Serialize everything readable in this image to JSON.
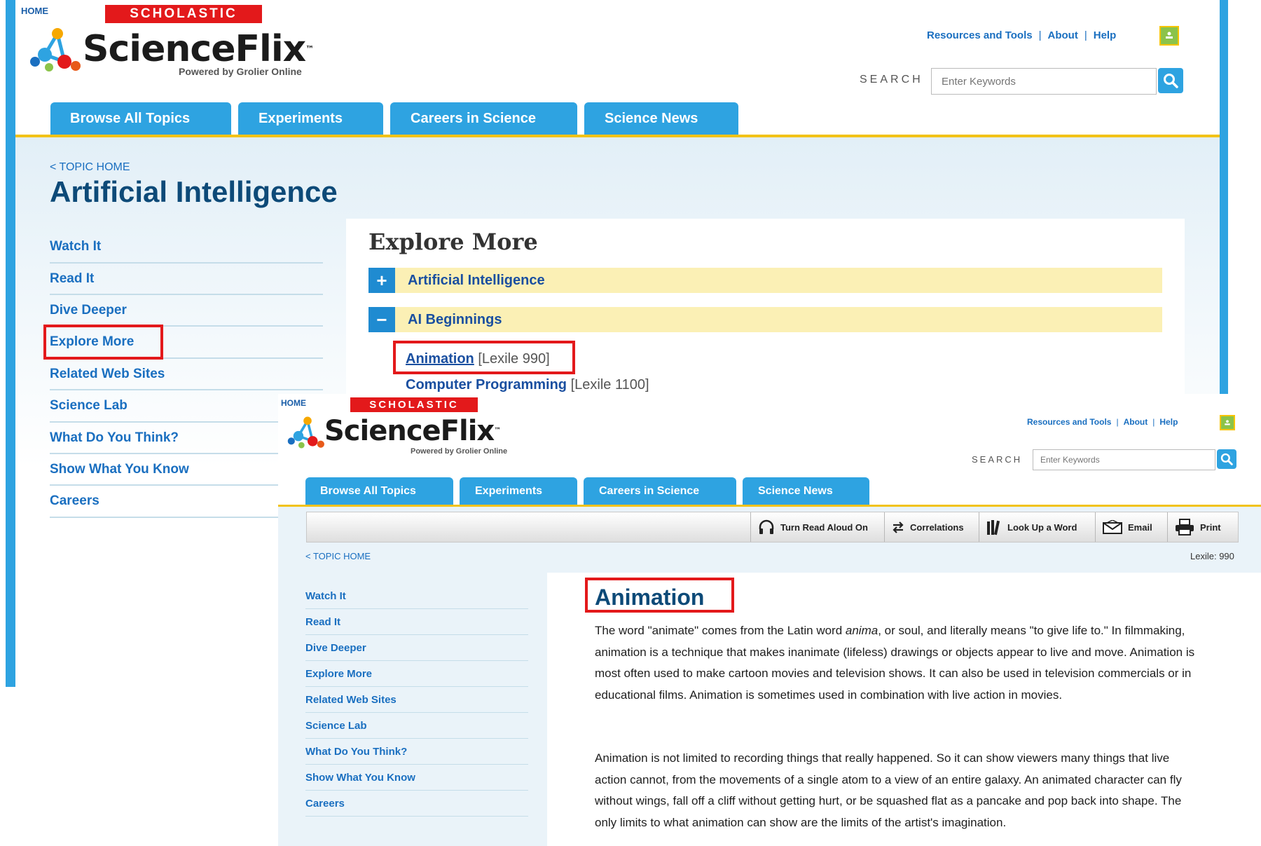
{
  "header": {
    "home_label": "HOME",
    "scholastic_label": "SCHOLASTIC",
    "logo_word": "ScienceFlix",
    "trademark": "™",
    "powered_by": "Powered by Grolier Online",
    "top_links": [
      "Resources and Tools",
      "About",
      "Help"
    ],
    "separator": "|",
    "search_label": "SEARCH",
    "search_placeholder": "Enter Keywords",
    "google_classroom_icon": "google-classroom-icon",
    "search_icon": "magnifier-icon"
  },
  "tabs": [
    "Browse All Topics",
    "Experiments",
    "Careers in Science",
    "Science News"
  ],
  "sidebar": {
    "items": [
      "Watch It",
      "Read It",
      "Dive Deeper",
      "Explore More",
      "Related Web Sites",
      "Science Lab",
      "What Do You Think?",
      "Show What You Know",
      "Careers"
    ],
    "highlighted": "Explore More"
  },
  "page1": {
    "topic_home": "< TOPIC HOME",
    "title": "Artificial Intelligence",
    "explore_heading": "Explore More",
    "accordion": [
      {
        "symbol": "+",
        "label": "Artificial Intelligence"
      },
      {
        "symbol": "−",
        "label": "AI Beginnings"
      }
    ],
    "articles": [
      {
        "title": "Animation",
        "lexile": "[Lexile 990]"
      },
      {
        "title": "Computer Programming",
        "lexile": "[Lexile 1100]"
      }
    ]
  },
  "page2": {
    "topic_home": "< TOPIC HOME",
    "lexile_readout": "Lexile: 990",
    "toolbar": [
      {
        "icon": "headphones-icon",
        "label": "Turn Read Aloud On"
      },
      {
        "icon": "swap-arrows-icon",
        "label": "Correlations"
      },
      {
        "icon": "books-icon",
        "label": "Look Up a Word"
      },
      {
        "icon": "envelope-icon",
        "label": "Email"
      },
      {
        "icon": "printer-icon",
        "label": "Print"
      }
    ],
    "article_title": "Animation",
    "para1": {
      "before": "The word \"animate\" comes from the Latin word ",
      "italic": "anima",
      "after": ", or soul, and literally means \"to give life to.\" In filmmaking, animation is a technique that makes inanimate (lifeless) drawings or objects appear to live and move. Animation is most often used to make cartoon movies and television shows. It can also be used in television commercials or in educational films. Animation is sometimes used in combination with live action in movies."
    },
    "para2": "Animation is not limited to recording things that really happened. So it can show viewers many things that live action cannot, from the movements of a single atom to a view of an entire galaxy. An animated character can fly without wings, fall off a cliff without getting hurt, or be squashed flat as a pancake and pop back into shape. The only limits to what animation can show are the limits of the artist's imagination."
  },
  "colors": {
    "accent_blue": "#2ea3e1",
    "highlight_yellow": "#f2c318",
    "scholastic_red": "#e3191b",
    "link_blue": "#1a6fc0"
  }
}
